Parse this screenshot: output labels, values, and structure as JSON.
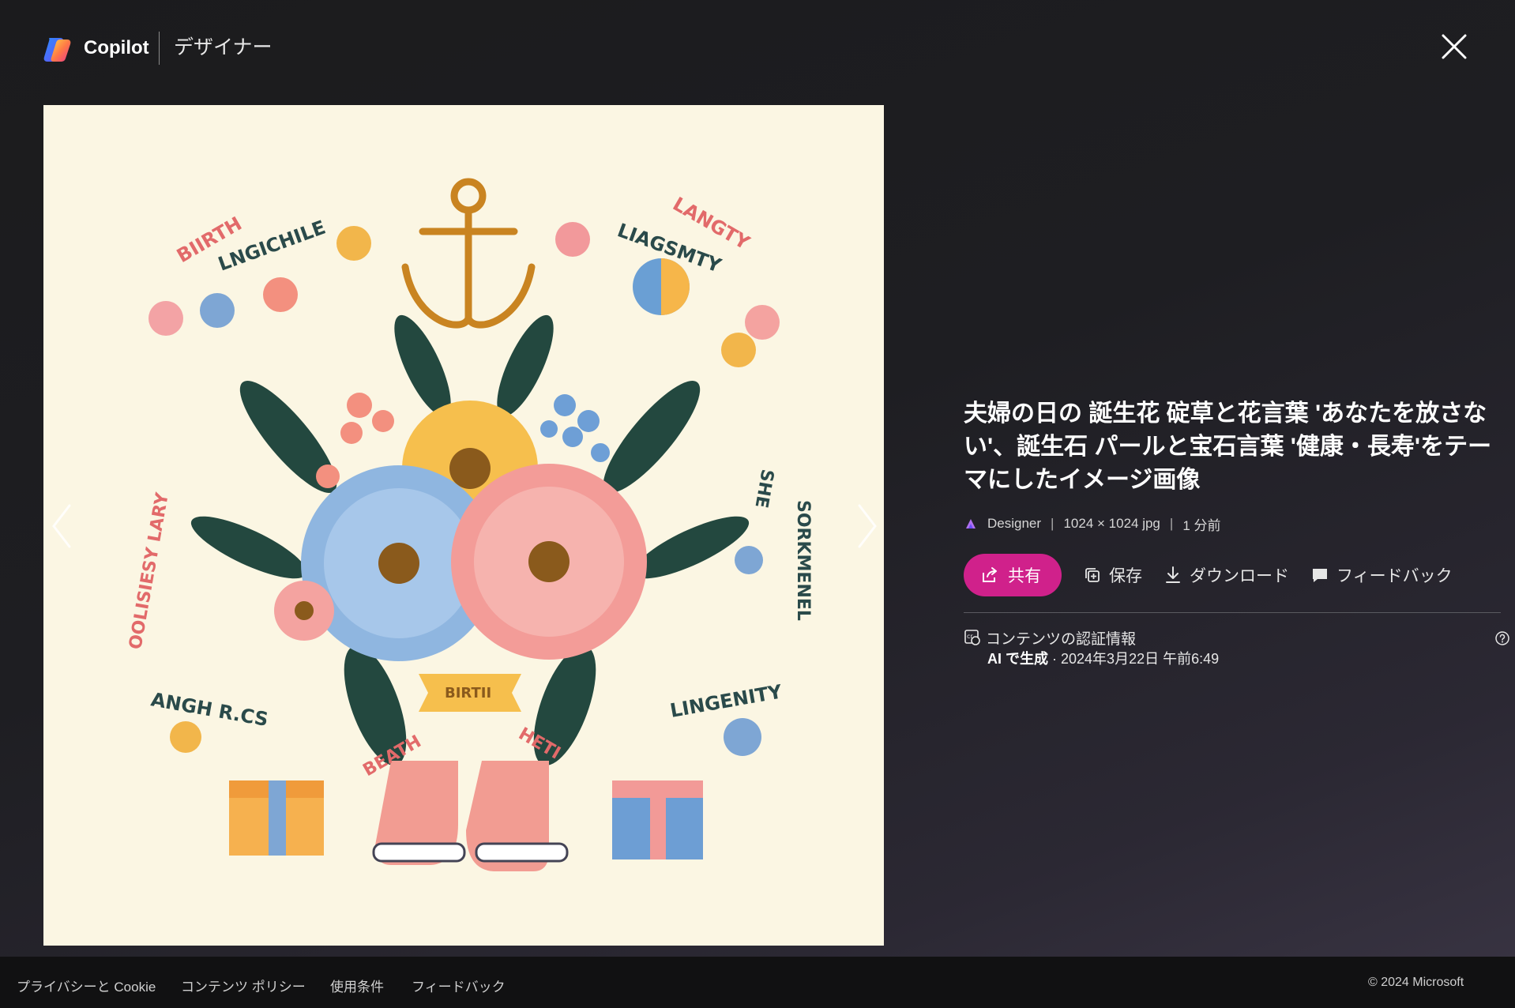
{
  "header": {
    "brand": "Copilot",
    "product": "デザイナー"
  },
  "image_panel": {
    "alt": "誕生花と誕生石をテーマにしたイメージ画像",
    "art_text": {
      "top_left_1": "BIIRTH",
      "top_left_2": "LNGICHILE",
      "top_right_1": "LANGTY",
      "top_right_2": "LIAGSMTY",
      "left_side": "OOLISIESY LARY",
      "right_side_1": "SHE",
      "right_side_2": "SORKMENEL",
      "bottom_left": "ANGH R.CS",
      "bottom_right": "LINGENITY",
      "ribbon": "BIRTII",
      "bottom_mid_left": "BEATH",
      "bottom_mid_right": "HETI"
    }
  },
  "info": {
    "title": "夫婦の日の 誕生花 碇草と花言葉 'あなたを放さない'、誕生石 パールと宝石言葉 '健康・長寿'をテーマにしたイメージ画像",
    "meta": {
      "source": "Designer",
      "size": "1024 × 1024 jpg",
      "time": "1 分前"
    },
    "actions": {
      "share": "共有",
      "save": "保存",
      "download": "ダウンロード",
      "feedback": "フィードバック"
    },
    "credentials": {
      "label": "コンテンツの認証情報",
      "generated": "AI で生成",
      "date": " · 2024年3月22日 午前6:49"
    }
  },
  "footer": {
    "links": [
      "プライバシーと Cookie",
      "コンテンツ ポリシー",
      "使用条件",
      "フィードバック"
    ],
    "copyright": "© 2024 Microsoft"
  },
  "colors": {
    "accent": "#d0218b",
    "image_bg": "#fbf6e3",
    "footer_bg": "#111112"
  }
}
